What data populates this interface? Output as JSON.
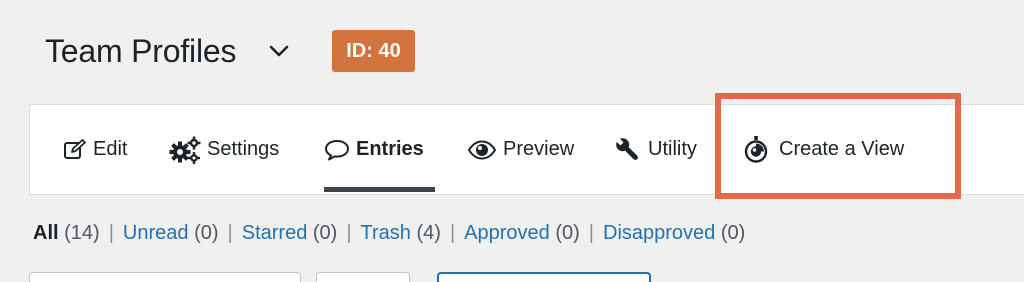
{
  "header": {
    "title": "Team Profiles",
    "badge": "ID: 40"
  },
  "tabs": [
    {
      "label": "Edit",
      "icon": "edit-icon"
    },
    {
      "label": "Settings",
      "icon": "gears-icon"
    },
    {
      "label": "Entries",
      "icon": "speech-bubble-icon",
      "active": true
    },
    {
      "label": "Preview",
      "icon": "eye-icon"
    },
    {
      "label": "Utility",
      "icon": "wrench-icon"
    },
    {
      "label": "Create a View",
      "icon": "gravityview-icon"
    }
  ],
  "filters": {
    "all": {
      "label": "All",
      "count": "(14)"
    },
    "unread": {
      "label": "Unread",
      "count": "(0)"
    },
    "starred": {
      "label": "Starred",
      "count": "(0)"
    },
    "trash": {
      "label": "Trash",
      "count": "(4)"
    },
    "approved": {
      "label": "Approved",
      "count": "(0)"
    },
    "disapproved": {
      "label": "Disapproved",
      "count": "(0)"
    },
    "separator": "|"
  },
  "colors": {
    "badge": "#d3733d",
    "highlight": "#e8674a",
    "link": "#2271b1",
    "active_underline": "#3c434a"
  }
}
